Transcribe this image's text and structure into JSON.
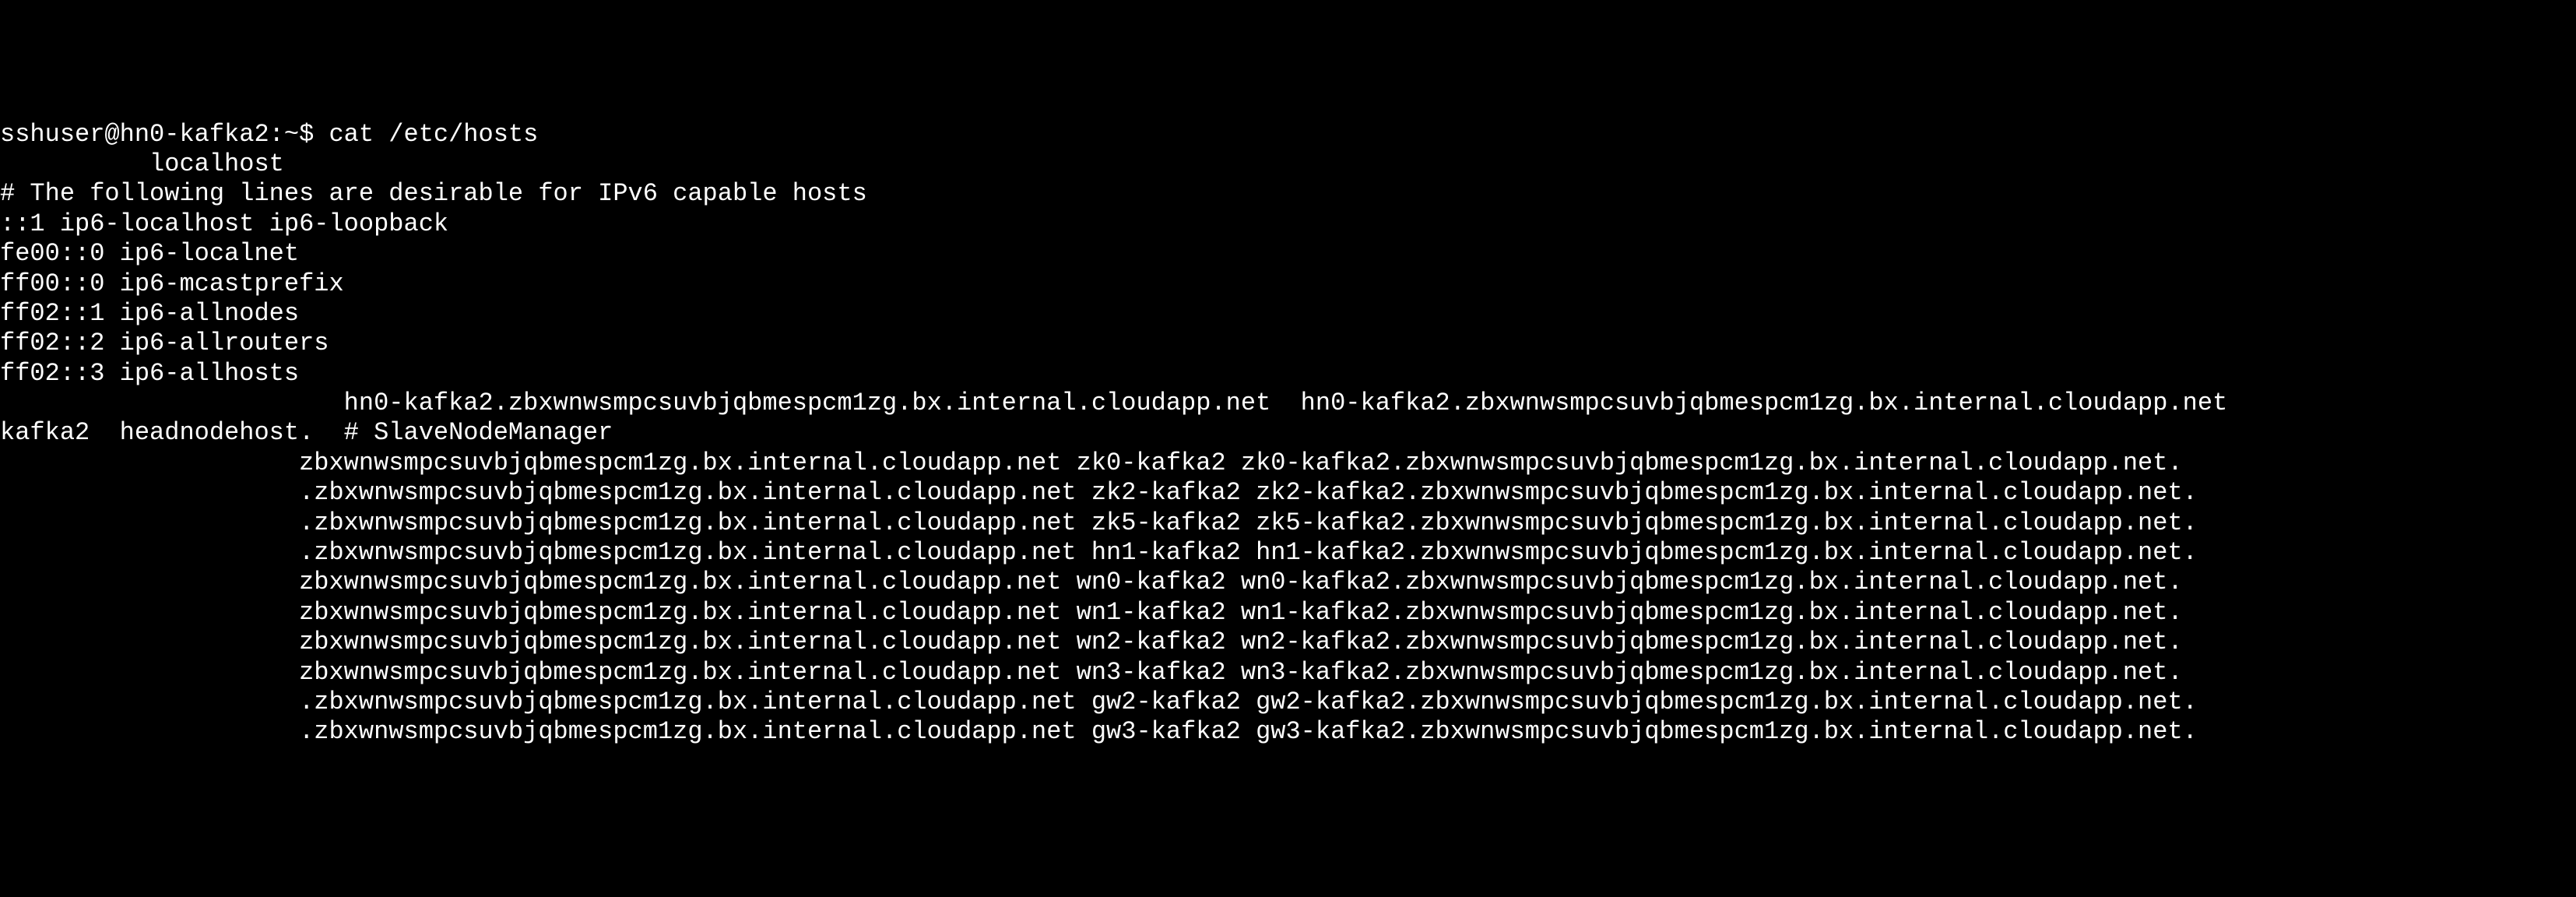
{
  "terminal": {
    "prompt": "sshuser@hn0-kafka2:~$ ",
    "command": "cat /etc/hosts",
    "lines": [
      "          localhost",
      "",
      "# The following lines are desirable for IPv6 capable hosts",
      "::1 ip6-localhost ip6-loopback",
      "fe00::0 ip6-localnet",
      "ff00::0 ip6-mcastprefix",
      "ff02::1 ip6-allnodes",
      "ff02::2 ip6-allrouters",
      "ff02::3 ip6-allhosts",
      "                       hn0-kafka2.zbxwnwsmpcsuvbjqbmespcm1zg.bx.internal.cloudapp.net  hn0-kafka2.zbxwnwsmpcsuvbjqbmespcm1zg.bx.internal.cloudapp.net",
      "kafka2  headnodehost.  # SlaveNodeManager",
      "                    zbxwnwsmpcsuvbjqbmespcm1zg.bx.internal.cloudapp.net zk0-kafka2 zk0-kafka2.zbxwnwsmpcsuvbjqbmespcm1zg.bx.internal.cloudapp.net.",
      "                    .zbxwnwsmpcsuvbjqbmespcm1zg.bx.internal.cloudapp.net zk2-kafka2 zk2-kafka2.zbxwnwsmpcsuvbjqbmespcm1zg.bx.internal.cloudapp.net.",
      "                    .zbxwnwsmpcsuvbjqbmespcm1zg.bx.internal.cloudapp.net zk5-kafka2 zk5-kafka2.zbxwnwsmpcsuvbjqbmespcm1zg.bx.internal.cloudapp.net.",
      "                    .zbxwnwsmpcsuvbjqbmespcm1zg.bx.internal.cloudapp.net hn1-kafka2 hn1-kafka2.zbxwnwsmpcsuvbjqbmespcm1zg.bx.internal.cloudapp.net.",
      "                    zbxwnwsmpcsuvbjqbmespcm1zg.bx.internal.cloudapp.net wn0-kafka2 wn0-kafka2.zbxwnwsmpcsuvbjqbmespcm1zg.bx.internal.cloudapp.net.",
      "                    zbxwnwsmpcsuvbjqbmespcm1zg.bx.internal.cloudapp.net wn1-kafka2 wn1-kafka2.zbxwnwsmpcsuvbjqbmespcm1zg.bx.internal.cloudapp.net.",
      "                    zbxwnwsmpcsuvbjqbmespcm1zg.bx.internal.cloudapp.net wn2-kafka2 wn2-kafka2.zbxwnwsmpcsuvbjqbmespcm1zg.bx.internal.cloudapp.net.",
      "                    zbxwnwsmpcsuvbjqbmespcm1zg.bx.internal.cloudapp.net wn3-kafka2 wn3-kafka2.zbxwnwsmpcsuvbjqbmespcm1zg.bx.internal.cloudapp.net.",
      "                    .zbxwnwsmpcsuvbjqbmespcm1zg.bx.internal.cloudapp.net gw2-kafka2 gw2-kafka2.zbxwnwsmpcsuvbjqbmespcm1zg.bx.internal.cloudapp.net.",
      "                    .zbxwnwsmpcsuvbjqbmespcm1zg.bx.internal.cloudapp.net gw3-kafka2 gw3-kafka2.zbxwnwsmpcsuvbjqbmespcm1zg.bx.internal.cloudapp.net."
    ]
  }
}
